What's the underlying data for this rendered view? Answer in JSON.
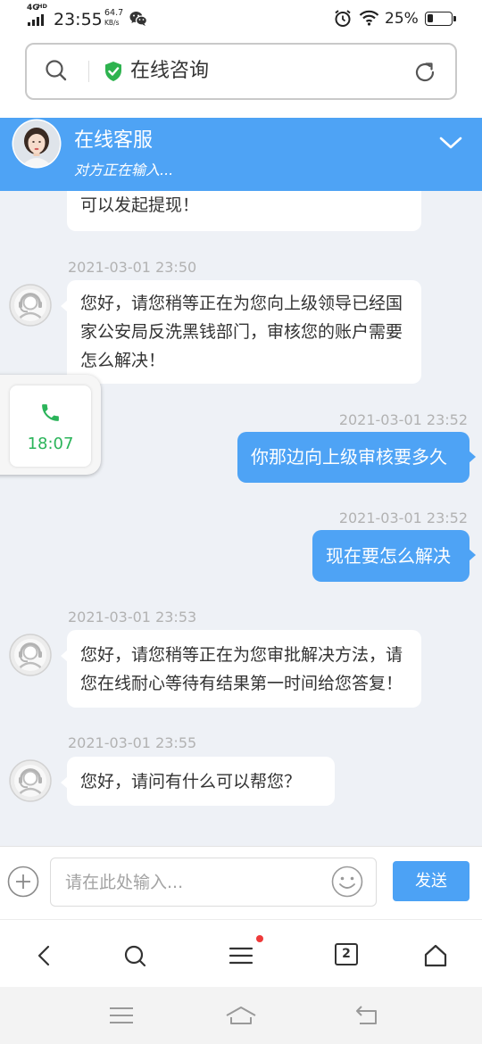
{
  "status_bar": {
    "network_type": "4G",
    "network_badge": "HD",
    "time": "23:55",
    "speed_value": "64.7",
    "speed_unit": "KB/s",
    "battery_percent": "25%",
    "battery_level": 0.25,
    "icons": [
      "signal-icon",
      "wechat-icon",
      "alarm-icon",
      "wifi-icon",
      "battery-icon"
    ]
  },
  "address_bar": {
    "title": "在线咨询",
    "icons": [
      "search-icon",
      "shield-check-icon",
      "refresh-icon"
    ]
  },
  "chat_header": {
    "title": "在线客服",
    "subtitle": "对方正在输入...",
    "icons": [
      "agent-photo-avatar",
      "chevron-down-icon"
    ]
  },
  "messages": [
    {
      "outgoing": false,
      "lines": [
        "可以发起提现！"
      ]
    },
    {
      "outgoing": false,
      "time": "2021-03-01 23:50",
      "lines": [
        "您好，请您稍等正在为您向上级领导已经国",
        "家公安局反洗黑钱部门，审核您的账户需要",
        "怎么解决！"
      ]
    },
    {
      "outgoing": true,
      "time": "2021-03-01 23:52",
      "lines": [
        "你那边向上级审核要多久"
      ]
    },
    {
      "outgoing": true,
      "time": "2021-03-01 23:52",
      "lines": [
        "现在要怎么解决"
      ]
    },
    {
      "outgoing": false,
      "time": "2021-03-01 23:53",
      "lines": [
        "您好，请您稍等正在为您审批解决方法，请",
        "您在线耐心等待有结果第一时间给您答复！"
      ]
    },
    {
      "outgoing": false,
      "time": "2021-03-01 23:55",
      "lines": [
        "您好，请问有什么可以帮您？"
      ]
    }
  ],
  "call_widget": {
    "time": "18:07",
    "icon": "phone-icon"
  },
  "input_bar": {
    "placeholder": "请在此处输入...",
    "send_label": "发送",
    "icons": [
      "plus-icon",
      "smiley-icon"
    ]
  },
  "browser_nav": {
    "tab_count": "2",
    "has_notification": true,
    "icons": [
      "back-icon",
      "search-icon",
      "menu-icon",
      "tabs-icon",
      "home-icon"
    ]
  },
  "system_nav": {
    "icons": [
      "recents-icon",
      "home-icon",
      "back-icon"
    ]
  },
  "colors": {
    "accent_blue": "#4ea3f5",
    "chat_background": "#eef1f6",
    "call_green": "#2bb45a",
    "verified_green": "#2eb34f",
    "notification_red": "#ee3a3a"
  }
}
